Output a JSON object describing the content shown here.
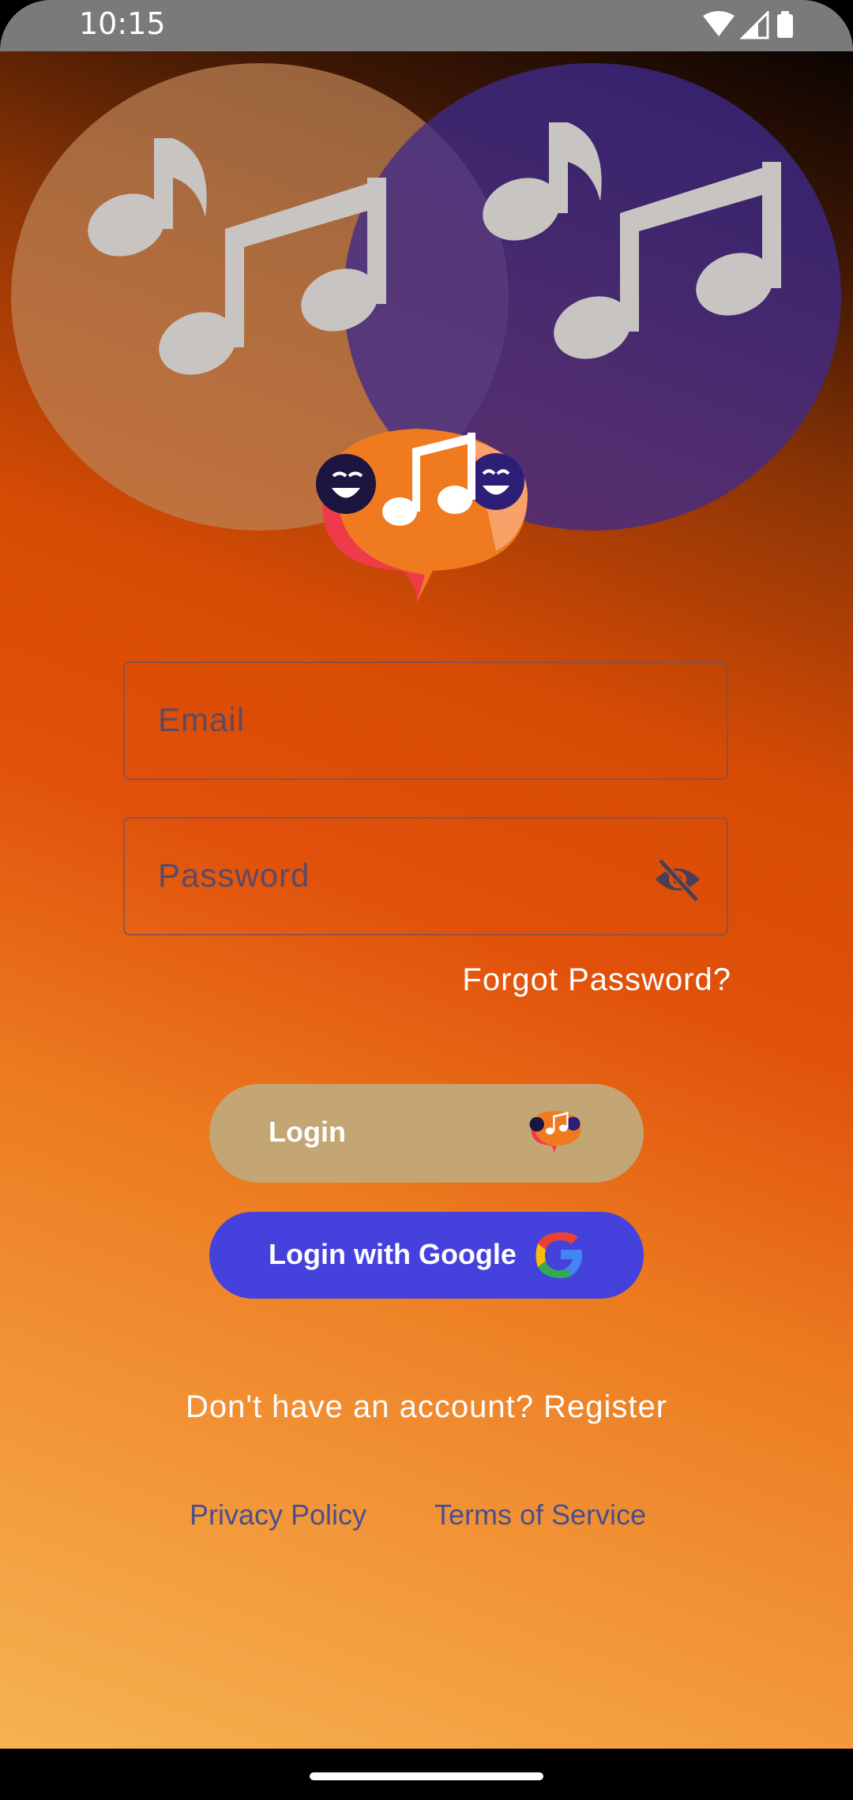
{
  "status_bar": {
    "time": "10:15",
    "icons": [
      "wifi-icon",
      "signal-icon",
      "battery-icon"
    ]
  },
  "login_form": {
    "email_label": "Email",
    "password_label": "Password",
    "forgot_password": "Forgot Password?",
    "login_button": "Login",
    "google_button": "Login with Google",
    "register_prompt": "Don't have an account? Register"
  },
  "footer": {
    "privacy": "Privacy Policy",
    "terms": "Terms of Service"
  },
  "colors": {
    "login_button": "#c4a574",
    "google_button": "#4541dc",
    "accent_orange": "#e0500a",
    "left_circle": "#bc8254",
    "right_circle": "#3e2a8c"
  }
}
